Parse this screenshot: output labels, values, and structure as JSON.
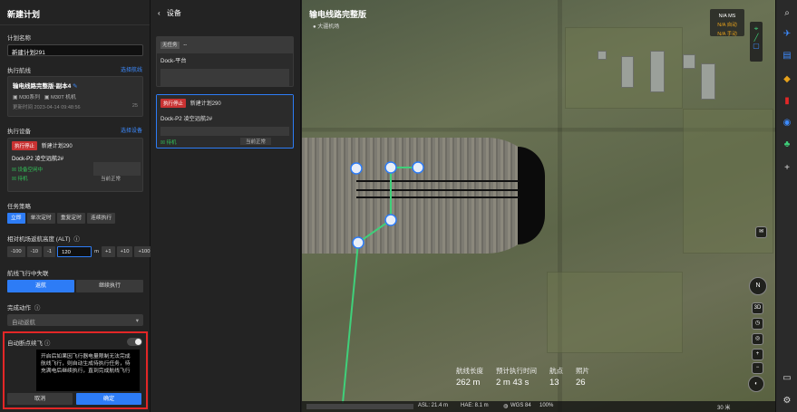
{
  "left": {
    "title": "新建计划",
    "plan_name_label": "计划名称",
    "plan_name_value": "新建计划291",
    "route_label": "执行航线",
    "route_link": "选择航线",
    "route_card": {
      "name": "输电线路完整版-副本4",
      "model_a": "M30系列",
      "model_b": "M30T 机机",
      "time": "更新时间 2023-04-14 09:48:56",
      "extra": "25"
    },
    "device_label": "执行设备",
    "device_link": "选择设备",
    "device_card": {
      "tag": "执行停止",
      "plan": "新建计划290",
      "dock": "Dock-P2 凌空远航2#",
      "status1": "设备空闲中",
      "status2": "待机",
      "state": "当前正常"
    },
    "strategy_label": "任务策略",
    "strategy_options": [
      "立即",
      "单次定时",
      "重复定时",
      "连续执行"
    ],
    "alt_label": "相对机场返航高度 (ALT)",
    "alt_buttons_minus": [
      "-100",
      "-10",
      "-1"
    ],
    "alt_value": "120",
    "alt_unit": "m",
    "alt_buttons_plus": [
      "+1",
      "+10",
      "+100"
    ],
    "lost_label": "航线飞行中失联",
    "lost_options": [
      "返航",
      "继续执行"
    ],
    "finish_label": "完成动作",
    "finish_value": "自动返航",
    "resume_label": "自动断点续飞",
    "tip_text": "开启后如果因飞行器电量限制无法完成航线飞行，则自动生成待执行任务，待充满电后继续执行，直到完成航线飞行",
    "cancel": "取消",
    "confirm": "确定"
  },
  "mid": {
    "back_label": "设备",
    "devices": [
      {
        "tag": "无任务",
        "name": "Dock-平台",
        "plan": "--"
      },
      {
        "tag": "执行停止",
        "plan": "新建计划290",
        "name": "Dock-P2 凌空远航2#",
        "status": "待机",
        "state": "当前正常"
      }
    ]
  },
  "map": {
    "title": "输电线路完整版",
    "subtitle": "大疆机场",
    "nav_line1": "N/A MS",
    "nav_line2": "N/A 自动",
    "nav_line3": "N/A 手动",
    "stats": [
      {
        "label": "航线长度",
        "value": "262 m"
      },
      {
        "label": "预计执行时间",
        "value": "2 m 43 s"
      },
      {
        "label": "航点",
        "value": "13"
      },
      {
        "label": "照片",
        "value": "26"
      }
    ],
    "bottom": {
      "asl": "ASL: 21.4 m",
      "hae": "HAE: 8.1 m",
      "wgs": "WGS 84",
      "zoom": "100%",
      "scale": "30 米"
    },
    "compass": "N",
    "btn_3d": "3D"
  }
}
